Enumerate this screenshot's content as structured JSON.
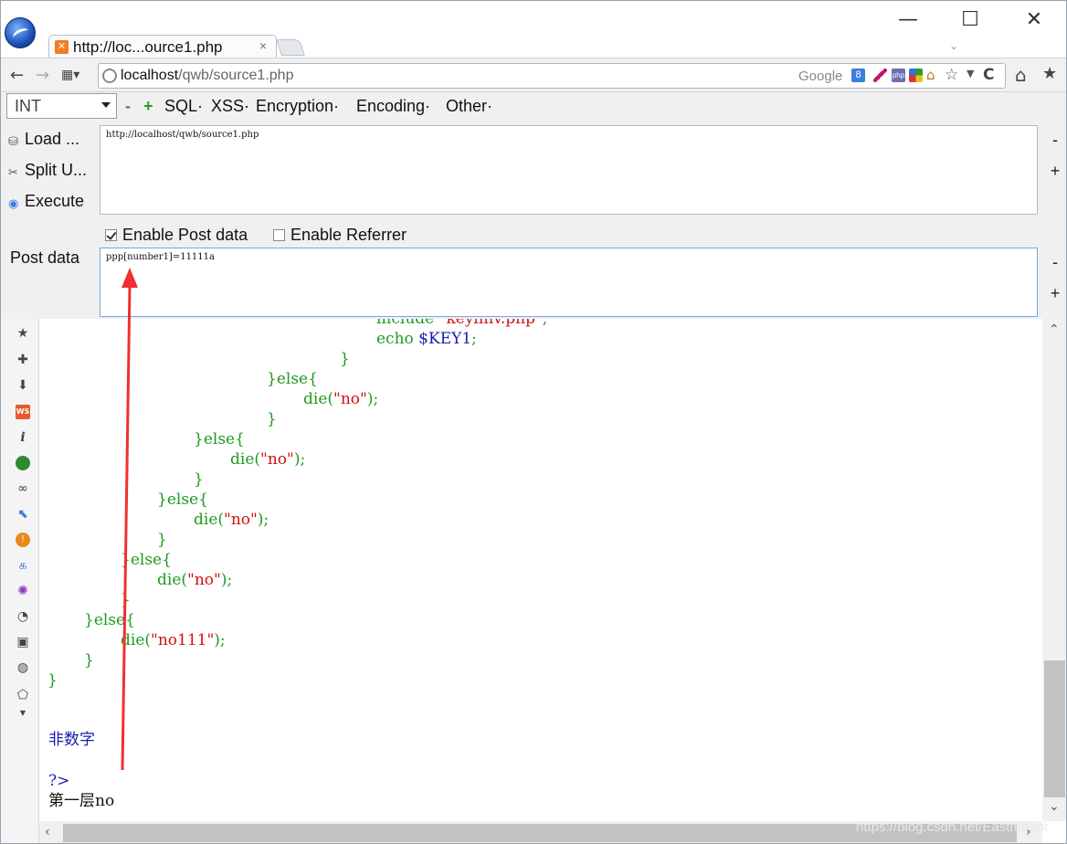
{
  "tab": {
    "title": "http://loc...ource1.php",
    "close": "×"
  },
  "window": {
    "minimize": "—",
    "maximize": "☐",
    "close": "✕",
    "tab_list": "⌄"
  },
  "nav": {
    "back": "←",
    "forward": "→",
    "apps": "▦▾",
    "url_host": "localhost",
    "url_path": "/qwb/source1.php",
    "search_engine": "Google",
    "search_badge": "8",
    "reload": "C",
    "home": "⌂",
    "bookmark": "★"
  },
  "hackbar": {
    "select_value": "INT",
    "minus": "-",
    "plus": "+",
    "menus": [
      "SQL·",
      "XSS·",
      "Encryption·",
      "Encoding·",
      "Other·"
    ],
    "load": "Load ...",
    "split": "Split U...",
    "execute": "Execute",
    "url_value": "http://localhost/qwb/source1.php",
    "enable_post": "Enable Post data",
    "enable_referrer": "Enable Referrer",
    "post_label": "Post data",
    "post_value": "ppp[number1]=11111a"
  },
  "code_lines": [
    {
      "t": "include \"keyllnv.php\";"
    },
    {
      "a": "echo ",
      "b": "$KEY1",
      "c": ";"
    },
    {
      "t": "}"
    },
    {
      "t": "}else{"
    },
    {
      "a": "die(",
      "b": "\"no\"",
      "c": ");"
    },
    {
      "t": "}"
    },
    {
      "t": "}else{"
    },
    {
      "a": "die(",
      "b": "\"no\"",
      "c": ");"
    },
    {
      "t": "}"
    },
    {
      "t": "}else{"
    },
    {
      "a": "die(",
      "b": "\"no\"",
      "c": ");"
    },
    {
      "t": "}"
    },
    {
      "t": "}else{"
    },
    {
      "a": "die(",
      "b": "\"no\"",
      "c": ");"
    },
    {
      "t": "}"
    },
    {
      "t": "}else{"
    },
    {
      "a": "die(",
      "b": "\"no111\"",
      "c": ");"
    },
    {
      "t": "}"
    },
    {
      "t": "}"
    }
  ],
  "output": {
    "non_number": "非数字",
    "php_close": "?>",
    "result": "第一层no"
  },
  "watermark": "https://blog.csdn.net/Eastmount",
  "colors": {
    "accent": "#6fa8e6",
    "code_green": "#1f9a1f",
    "code_red": "#d01010",
    "arrow": "#f03030"
  }
}
